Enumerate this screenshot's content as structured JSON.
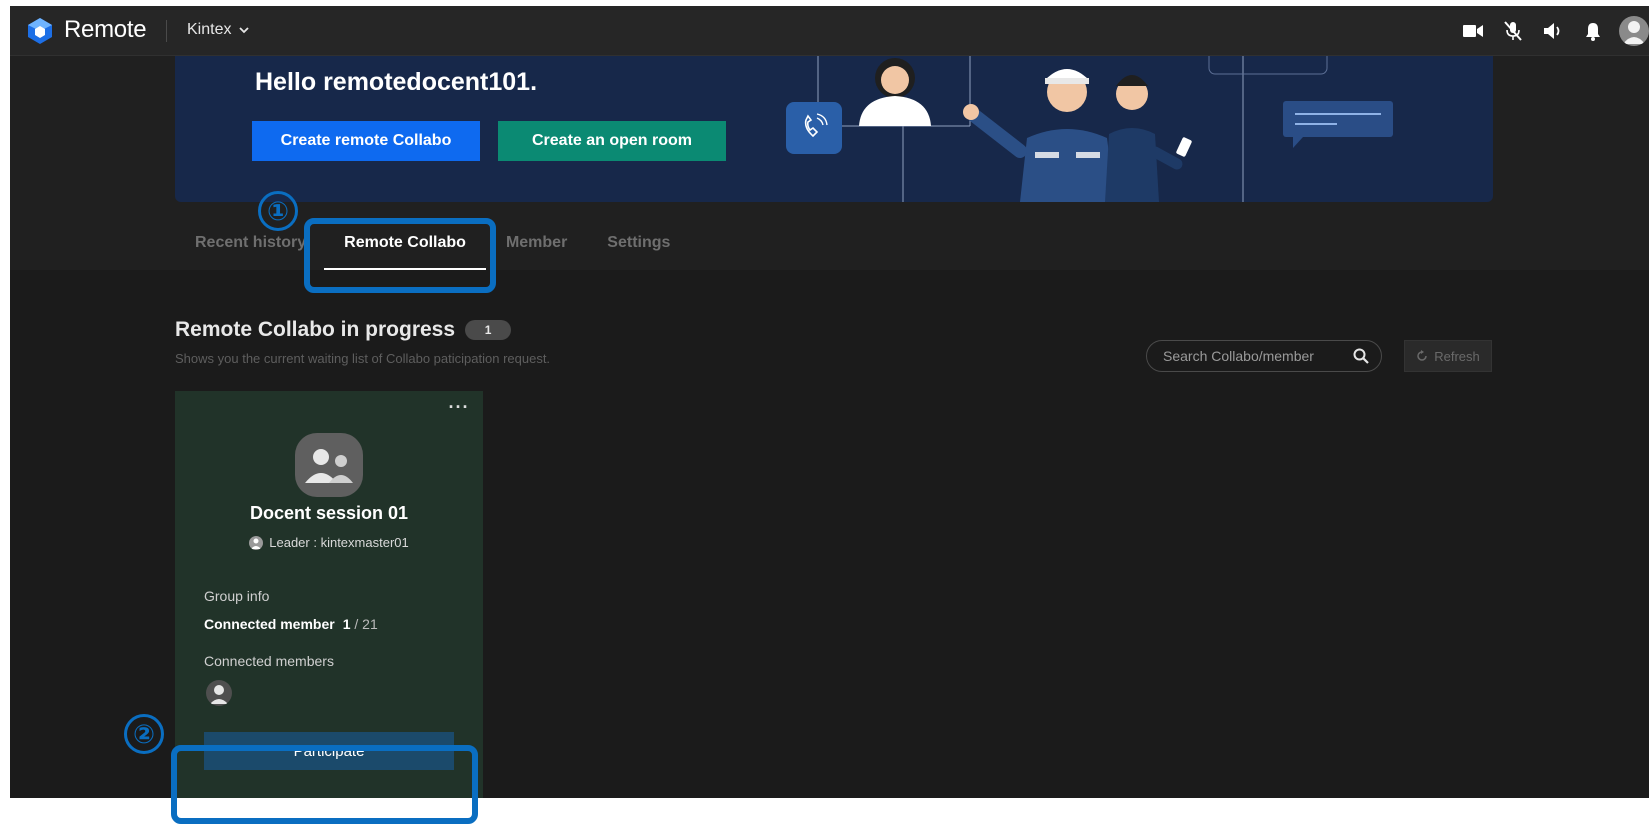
{
  "header": {
    "brand": "Remote",
    "workspace": "Kintex",
    "icons": [
      "camera-icon",
      "mic-muted-icon",
      "speaker-icon",
      "bell-icon",
      "user-avatar-icon"
    ]
  },
  "banner": {
    "greeting": "Hello remotedocent101.",
    "create_collabo_label": "Create remote Collabo",
    "create_open_room_label": "Create an open room"
  },
  "tabs": [
    {
      "label": "Recent history",
      "active": false
    },
    {
      "label": "Remote Collabo",
      "active": true
    },
    {
      "label": "Member",
      "active": false
    },
    {
      "label": "Settings",
      "active": false
    }
  ],
  "section": {
    "title": "Remote Collabo in progress",
    "count": "1",
    "subtitle": "Shows you the current waiting list of Collabo paticipation request.",
    "search_placeholder": "Search Collabo/member",
    "refresh_label": "Refresh"
  },
  "card": {
    "more_label": "···",
    "title": "Docent session 01",
    "leader": "Leader : kintexmaster01",
    "group_info_label": "Group info",
    "connected_label": "Connected member",
    "connected_count": "1",
    "connected_total": "/ 21",
    "members_label": "Connected members",
    "participate_label": "Participate"
  },
  "annotations": [
    {
      "number": "①"
    },
    {
      "number": "②"
    }
  ],
  "colors": {
    "background": "#1b1b1b",
    "topbar": "#262626",
    "banner": "#17284a",
    "primary_blue": "#0e6af0",
    "green": "#0b8a73",
    "card": "#213329",
    "participate": "#1b4a6b",
    "annotation": "#0a6ec1"
  }
}
